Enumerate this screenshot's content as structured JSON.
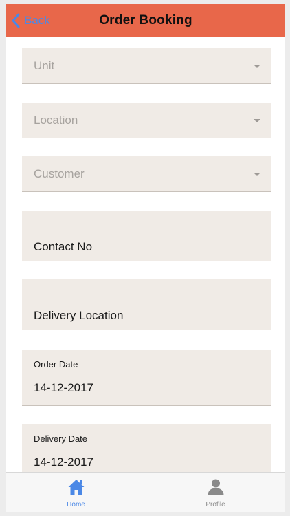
{
  "header": {
    "back_label": "Back",
    "title": "Order Booking"
  },
  "form": {
    "unit_placeholder": "Unit",
    "location_placeholder": "Location",
    "customer_placeholder": "Customer",
    "contact_no": "Contact No",
    "delivery_location": "Delivery Location",
    "order_date_label": "Order Date",
    "order_date_value": "14-12-2017",
    "delivery_date_label": "Delivery Date",
    "delivery_date_value": "14-12-2017"
  },
  "tabs": [
    {
      "label": "Home",
      "icon": "home-icon",
      "active": true
    },
    {
      "label": "Profile",
      "icon": "person-icon",
      "active": false
    }
  ],
  "colors": {
    "header_bg": "#e8674a",
    "field_bg": "#f0ebe6",
    "accent": "#4b88e6"
  }
}
